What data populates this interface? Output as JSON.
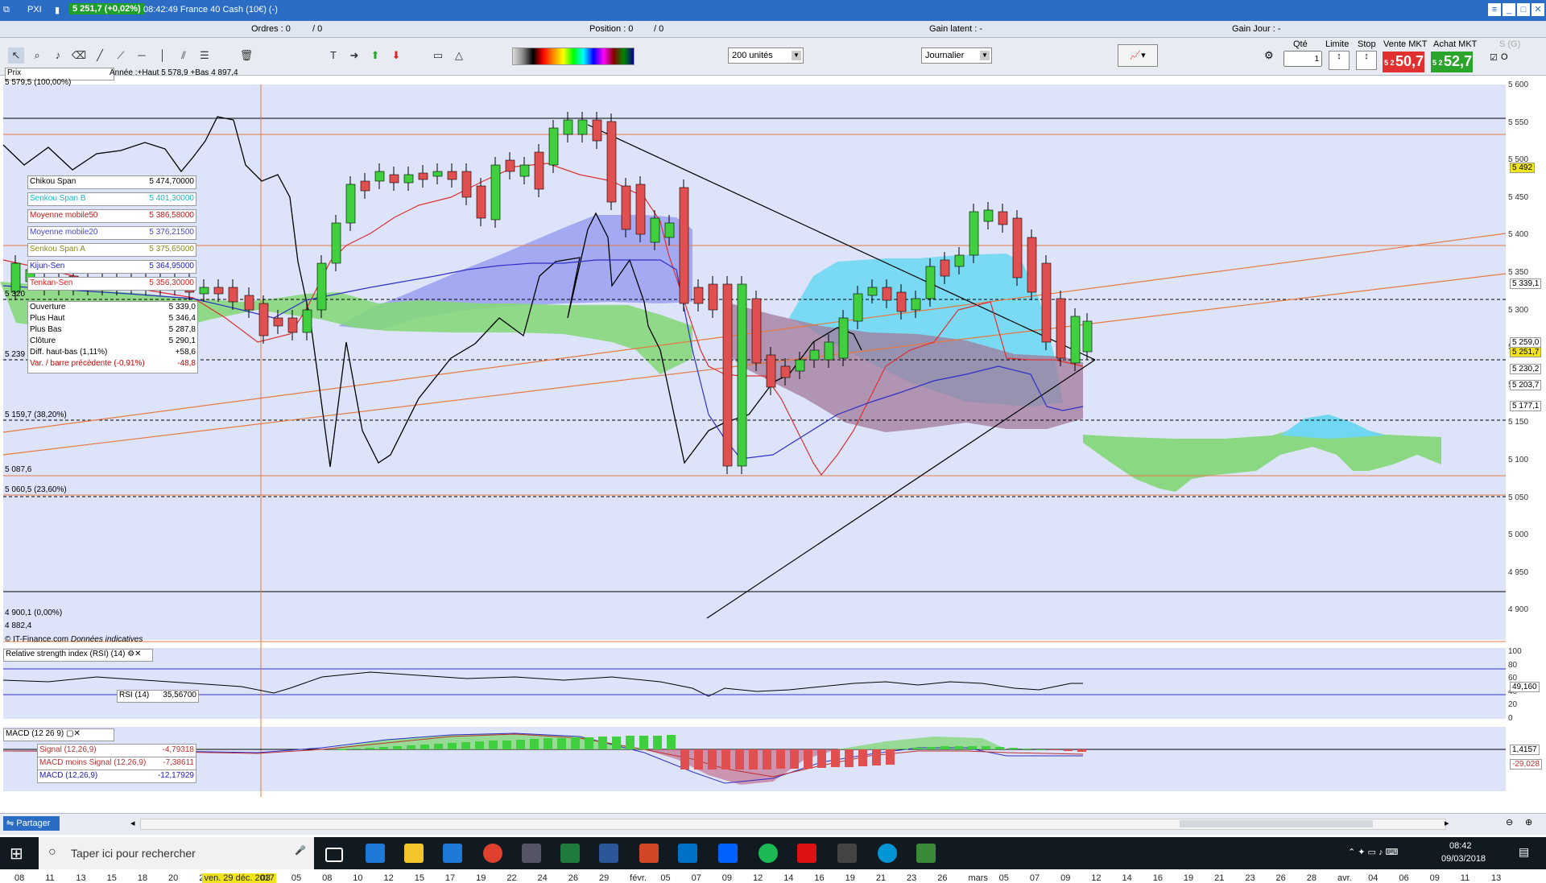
{
  "window": {
    "app_name": "PXI",
    "price": "5 251,7 (+0,02%)",
    "time_instrument": "08:42:49 France 40 Cash (10€) (-)"
  },
  "infobar": {
    "ordres": "Ordres : 0",
    "ordres_b": "/ 0",
    "position": "Position : 0",
    "position_b": "/ 0",
    "gain_latent": "Gain latent : -",
    "gain_jour": "Gain Jour : -"
  },
  "toolbar": {
    "units_select": "200 unités",
    "period_select": "Journalier",
    "qty_label": "Qté",
    "qty_value": "1",
    "limite_label": "Limite",
    "stop_label": "Stop",
    "vente_label": "Vente MKT",
    "achat_label": "Achat MKT",
    "vente_small": "5 2",
    "vente_big": "50,7",
    "achat_small": "5 2",
    "achat_big": "52,7",
    "sg_label": "S (G)",
    "o_label": "O"
  },
  "chart": {
    "header": "Année :+Haut 5 578,9 +Bas 4 897,4",
    "prix_label": "Prix",
    "fib_100": "5 579,5 (100,00%)",
    "fib_382": "5 159,7 (38,20%)",
    "fib_236": "5 060,5 (23,60%)",
    "fib_0": "4 900,1 (0,00%)",
    "level_5320": "5 320",
    "level_5239": "5 239",
    "level_5087": "5 087,6",
    "level_4882": "4 882,4",
    "copyright_a": "© IT-Finance.com",
    "copyright_b": "Données indicatives",
    "legend": [
      {
        "name": "Chikou Span",
        "value": "5 474,70000",
        "color": "#000000"
      },
      {
        "name": "Senkou Span B",
        "value": "5 401,30000",
        "color": "#19b8c8"
      },
      {
        "name": "Moyenne mobile50",
        "value": "5 386,58000",
        "color": "#c01818"
      },
      {
        "name": "Moyenne mobile20",
        "value": "5 376,21500",
        "color": "#4848c8"
      },
      {
        "name": "Senkou Span A",
        "value": "5 375,65000",
        "color": "#8a8a20"
      },
      {
        "name": "Kijun-Sen",
        "value": "5 364,95000",
        "color": "#2020c0"
      },
      {
        "name": "Tenkan-Sen",
        "value": "5 356,30000",
        "color": "#e02020"
      }
    ],
    "ohlc": [
      {
        "name": "Ouverture",
        "value": "5 339,0"
      },
      {
        "name": "Plus Haut",
        "value": "5 346,4"
      },
      {
        "name": "Plus Bas",
        "value": "5 287,8"
      },
      {
        "name": "Clôture",
        "value": "5 290,1"
      },
      {
        "name": "Diff. haut-bas (1,11%)",
        "value": "+58,6"
      },
      {
        "name": "Var. / barre précédente (-0,91%)",
        "value": "-48,8"
      }
    ],
    "y_labels": [
      "5 600",
      "5 550",
      "5 500",
      "5 450",
      "5 400",
      "5 350",
      "5 300",
      "5 250",
      "5 200",
      "5 150",
      "5 100",
      "5 050",
      "5 000",
      "4 950",
      "4 900"
    ],
    "right_tags": [
      {
        "text": "5 492",
        "bg": "#f2e41a"
      },
      {
        "text": "5 339,1",
        "bg": "#ffffff"
      },
      {
        "text": "5 259,0",
        "bg": "#ffffff"
      },
      {
        "text": "5 251,7",
        "bg": "#f2e41a"
      },
      {
        "text": "5 230,2",
        "bg": "#ffffff"
      },
      {
        "text": "5 203,7",
        "bg": "#ffffff"
      },
      {
        "text": "5 177,1",
        "bg": "#ffffff"
      }
    ],
    "rsi_title": "Relative strength index (RSI) (14)",
    "rsi_legend_name": "RSI (14)",
    "rsi_legend_value": "35,56700",
    "rsi_y": [
      "100",
      "80",
      "60",
      "40",
      "20",
      "0"
    ],
    "rsi_tag": "49,160",
    "macd_title": "MACD (12 26 9)",
    "macd_legend": [
      {
        "name": "Signal (12,26,9)",
        "value": "-4,79318"
      },
      {
        "name": "MACD moins Signal (12,26,9)",
        "value": "-7,38611"
      },
      {
        "name": "MACD (12,26,9)",
        "value": "-12,17929"
      }
    ],
    "macd_tags": [
      "1,4157",
      "-29,028"
    ],
    "x_labels": [
      "08",
      "11",
      "13",
      "15",
      "18",
      "20",
      "22",
      "ven. 29 déc. 2017",
      "03",
      "05",
      "08",
      "10",
      "12",
      "15",
      "17",
      "19",
      "22",
      "24",
      "26",
      "29",
      "févr.",
      "05",
      "07",
      "09",
      "12",
      "14",
      "16",
      "19",
      "21",
      "23",
      "26",
      "mars",
      "05",
      "07",
      "09",
      "12",
      "14",
      "16",
      "19",
      "21",
      "23",
      "26",
      "28",
      "avr.",
      "04",
      "06",
      "09",
      "11",
      "13"
    ]
  },
  "bottom": {
    "share_button": "Partager"
  },
  "taskbar": {
    "search_placeholder": "Taper ici pour rechercher",
    "time": "08:42",
    "date": "09/03/2018"
  }
}
